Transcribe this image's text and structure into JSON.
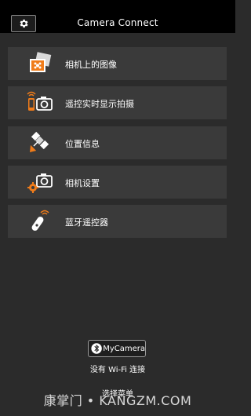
{
  "header": {
    "title": "Camera Connect",
    "settings_icon": "gear-icon"
  },
  "menu": [
    {
      "label": "相机上的图像",
      "icon": "photo-gallery-icon"
    },
    {
      "label": "遥控实时显示拍摄",
      "icon": "remote-camera-icon"
    },
    {
      "label": "位置信息",
      "icon": "satellite-icon"
    },
    {
      "label": "相机设置",
      "icon": "camera-settings-icon"
    },
    {
      "label": "蓝牙遥控器",
      "icon": "bluetooth-remote-icon"
    }
  ],
  "footer": {
    "mycamera_label": "MyCamera",
    "wifi_status": "没有 Wi-Fi 连接",
    "select_menu": "选择菜单"
  },
  "watermark": "康掌门 • KANGZM.COM",
  "colors": {
    "accent": "#f07c1a",
    "header_bg": "#000000",
    "page_bg": "#2b2b2b",
    "item_bg": "#3a3a3a"
  }
}
